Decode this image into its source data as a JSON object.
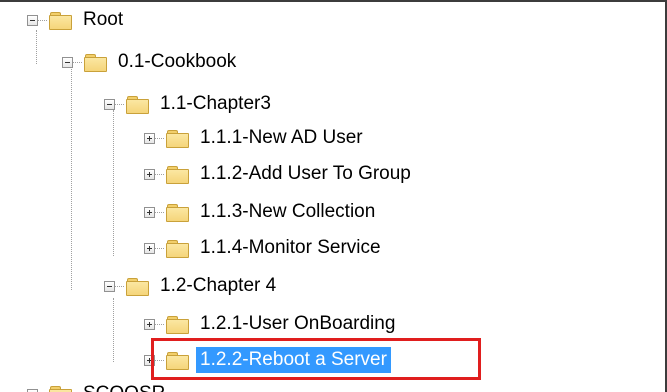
{
  "tree": {
    "nodes": [
      {
        "label": "Root",
        "expander": "minus",
        "selected": false
      },
      {
        "label": "0.1-Cookbook",
        "expander": "minus",
        "selected": false
      },
      {
        "label": "1.1-Chapter3",
        "expander": "minus",
        "selected": false
      },
      {
        "label": "1.1.1-New AD User",
        "expander": "plus",
        "selected": false
      },
      {
        "label": "1.1.2-Add User To Group",
        "expander": "plus",
        "selected": false
      },
      {
        "label": "1.1.3-New Collection",
        "expander": "plus",
        "selected": false
      },
      {
        "label": "1.1.4-Monitor Service",
        "expander": "plus",
        "selected": false
      },
      {
        "label": "1.2-Chapter 4",
        "expander": "minus",
        "selected": false
      },
      {
        "label": "1.2.1-User OnBoarding",
        "expander": "plus",
        "selected": false
      },
      {
        "label": "1.2.2-Reboot a Server",
        "expander": "plus",
        "selected": true
      },
      {
        "label": "SCOOSR",
        "expander": "plus",
        "selected": false
      }
    ]
  },
  "colors": {
    "selection": "#3399ff",
    "highlight_box": "#e01e1e",
    "folder": "#f5d57a"
  },
  "icons": {
    "folder": "folder-icon",
    "expand": "plus-icon",
    "collapse": "minus-icon"
  }
}
